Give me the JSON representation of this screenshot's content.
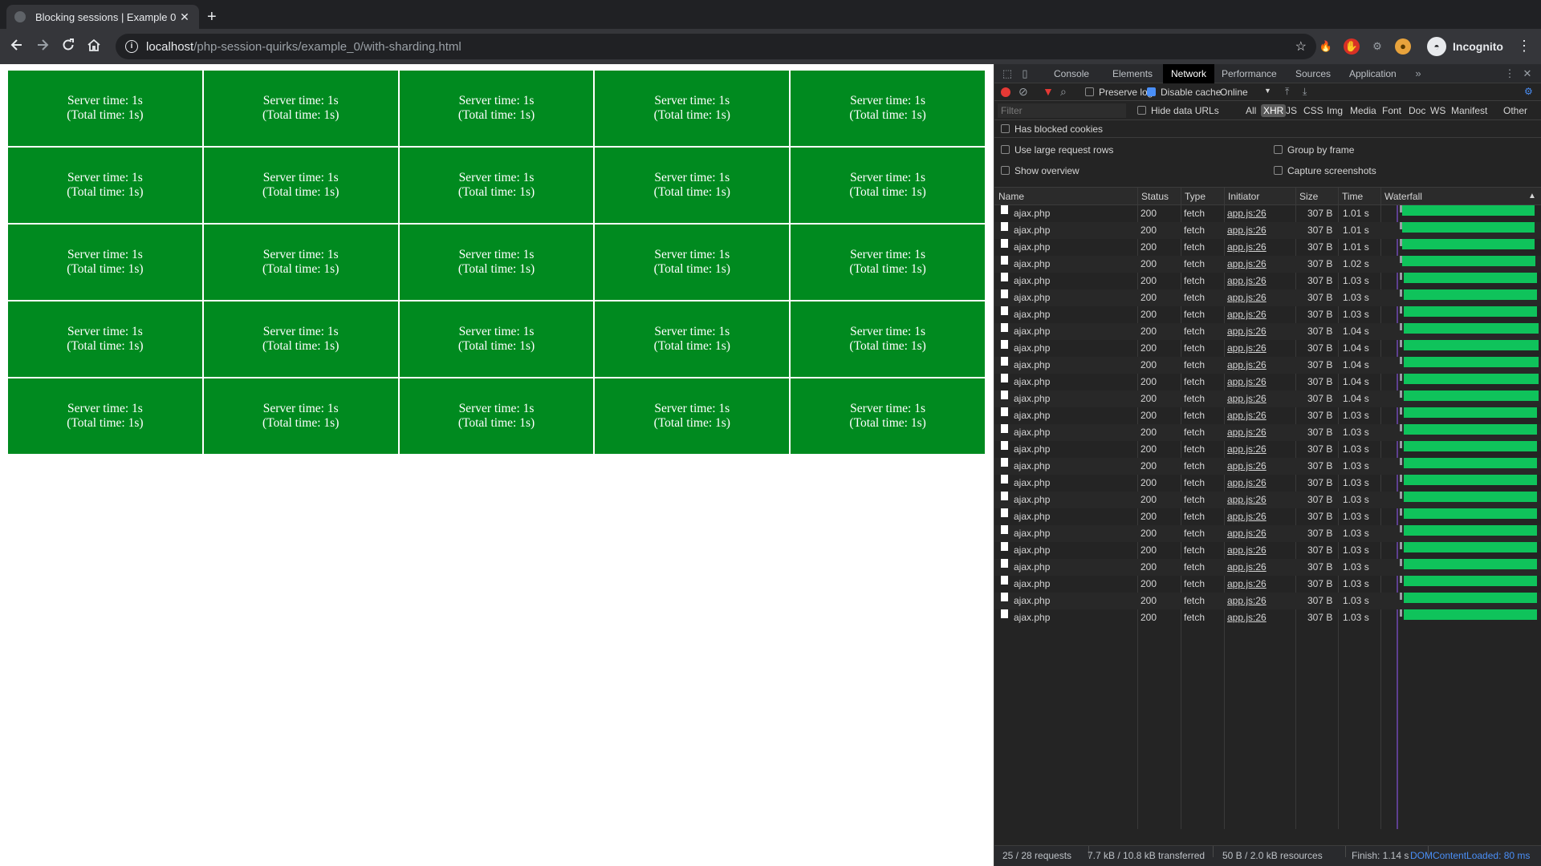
{
  "browser": {
    "tab_title": "Blocking sessions | Example 0",
    "tab_close": "✕",
    "new_tab": "+",
    "url_host": "localhost",
    "url_path": "/php-session-quirks/example_0/with-sharding.html",
    "profile_label": "Incognito"
  },
  "page": {
    "cells": [
      {
        "line1": "Server time: 1s",
        "line2": "(Total time: 1s)"
      },
      {
        "line1": "Server time: 1s",
        "line2": "(Total time: 1s)"
      },
      {
        "line1": "Server time: 1s",
        "line2": "(Total time: 1s)"
      },
      {
        "line1": "Server time: 1s",
        "line2": "(Total time: 1s)"
      },
      {
        "line1": "Server time: 1s",
        "line2": "(Total time: 1s)"
      },
      {
        "line1": "Server time: 1s",
        "line2": "(Total time: 1s)"
      },
      {
        "line1": "Server time: 1s",
        "line2": "(Total time: 1s)"
      },
      {
        "line1": "Server time: 1s",
        "line2": "(Total time: 1s)"
      },
      {
        "line1": "Server time: 1s",
        "line2": "(Total time: 1s)"
      },
      {
        "line1": "Server time: 1s",
        "line2": "(Total time: 1s)"
      },
      {
        "line1": "Server time: 1s",
        "line2": "(Total time: 1s)"
      },
      {
        "line1": "Server time: 1s",
        "line2": "(Total time: 1s)"
      },
      {
        "line1": "Server time: 1s",
        "line2": "(Total time: 1s)"
      },
      {
        "line1": "Server time: 1s",
        "line2": "(Total time: 1s)"
      },
      {
        "line1": "Server time: 1s",
        "line2": "(Total time: 1s)"
      },
      {
        "line1": "Server time: 1s",
        "line2": "(Total time: 1s)"
      },
      {
        "line1": "Server time: 1s",
        "line2": "(Total time: 1s)"
      },
      {
        "line1": "Server time: 1s",
        "line2": "(Total time: 1s)"
      },
      {
        "line1": "Server time: 1s",
        "line2": "(Total time: 1s)"
      },
      {
        "line1": "Server time: 1s",
        "line2": "(Total time: 1s)"
      },
      {
        "line1": "Server time: 1s",
        "line2": "(Total time: 1s)"
      },
      {
        "line1": "Server time: 1s",
        "line2": "(Total time: 1s)"
      },
      {
        "line1": "Server time: 1s",
        "line2": "(Total time: 1s)"
      },
      {
        "line1": "Server time: 1s",
        "line2": "(Total time: 1s)"
      },
      {
        "line1": "Server time: 1s",
        "line2": "(Total time: 1s)"
      }
    ],
    "cell_color": "#008a1f"
  },
  "devtools": {
    "tabs": [
      "Console",
      "Elements",
      "Network",
      "Performance",
      "Sources",
      "Application"
    ],
    "active_tab": "Network",
    "more_tabs": "»",
    "preserve_log": "Preserve log",
    "disable_cache": "Disable cache",
    "throttling": "Online",
    "filter_placeholder": "Filter",
    "hide_data_urls": "Hide data URLs",
    "type_filters": [
      "All",
      "XHR",
      "JS",
      "CSS",
      "Img",
      "Media",
      "Font",
      "Doc",
      "WS",
      "Manifest",
      "Other"
    ],
    "active_type": "XHR",
    "has_blocked_cookies": "Has blocked cookies",
    "use_large_rows": "Use large request rows",
    "group_by_frame": "Group by frame",
    "show_overview": "Show overview",
    "capture_screenshots": "Capture screenshots",
    "columns": [
      "Name",
      "Status",
      "Type",
      "Initiator",
      "Size",
      "Time",
      "Waterfall"
    ],
    "sort_indicator": "▲",
    "requests": [
      {
        "name": "ajax.php",
        "status": "200",
        "type": "fetch",
        "initiator": "app.js:26",
        "size": "307 B",
        "time": "1.01 s"
      },
      {
        "name": "ajax.php",
        "status": "200",
        "type": "fetch",
        "initiator": "app.js:26",
        "size": "307 B",
        "time": "1.01 s"
      },
      {
        "name": "ajax.php",
        "status": "200",
        "type": "fetch",
        "initiator": "app.js:26",
        "size": "307 B",
        "time": "1.01 s"
      },
      {
        "name": "ajax.php",
        "status": "200",
        "type": "fetch",
        "initiator": "app.js:26",
        "size": "307 B",
        "time": "1.02 s"
      },
      {
        "name": "ajax.php",
        "status": "200",
        "type": "fetch",
        "initiator": "app.js:26",
        "size": "307 B",
        "time": "1.03 s"
      },
      {
        "name": "ajax.php",
        "status": "200",
        "type": "fetch",
        "initiator": "app.js:26",
        "size": "307 B",
        "time": "1.03 s"
      },
      {
        "name": "ajax.php",
        "status": "200",
        "type": "fetch",
        "initiator": "app.js:26",
        "size": "307 B",
        "time": "1.03 s"
      },
      {
        "name": "ajax.php",
        "status": "200",
        "type": "fetch",
        "initiator": "app.js:26",
        "size": "307 B",
        "time": "1.04 s"
      },
      {
        "name": "ajax.php",
        "status": "200",
        "type": "fetch",
        "initiator": "app.js:26",
        "size": "307 B",
        "time": "1.04 s"
      },
      {
        "name": "ajax.php",
        "status": "200",
        "type": "fetch",
        "initiator": "app.js:26",
        "size": "307 B",
        "time": "1.04 s"
      },
      {
        "name": "ajax.php",
        "status": "200",
        "type": "fetch",
        "initiator": "app.js:26",
        "size": "307 B",
        "time": "1.04 s"
      },
      {
        "name": "ajax.php",
        "status": "200",
        "type": "fetch",
        "initiator": "app.js:26",
        "size": "307 B",
        "time": "1.04 s"
      },
      {
        "name": "ajax.php",
        "status": "200",
        "type": "fetch",
        "initiator": "app.js:26",
        "size": "307 B",
        "time": "1.03 s"
      },
      {
        "name": "ajax.php",
        "status": "200",
        "type": "fetch",
        "initiator": "app.js:26",
        "size": "307 B",
        "time": "1.03 s"
      },
      {
        "name": "ajax.php",
        "status": "200",
        "type": "fetch",
        "initiator": "app.js:26",
        "size": "307 B",
        "time": "1.03 s"
      },
      {
        "name": "ajax.php",
        "status": "200",
        "type": "fetch",
        "initiator": "app.js:26",
        "size": "307 B",
        "time": "1.03 s"
      },
      {
        "name": "ajax.php",
        "status": "200",
        "type": "fetch",
        "initiator": "app.js:26",
        "size": "307 B",
        "time": "1.03 s"
      },
      {
        "name": "ajax.php",
        "status": "200",
        "type": "fetch",
        "initiator": "app.js:26",
        "size": "307 B",
        "time": "1.03 s"
      },
      {
        "name": "ajax.php",
        "status": "200",
        "type": "fetch",
        "initiator": "app.js:26",
        "size": "307 B",
        "time": "1.03 s"
      },
      {
        "name": "ajax.php",
        "status": "200",
        "type": "fetch",
        "initiator": "app.js:26",
        "size": "307 B",
        "time": "1.03 s"
      },
      {
        "name": "ajax.php",
        "status": "200",
        "type": "fetch",
        "initiator": "app.js:26",
        "size": "307 B",
        "time": "1.03 s"
      },
      {
        "name": "ajax.php",
        "status": "200",
        "type": "fetch",
        "initiator": "app.js:26",
        "size": "307 B",
        "time": "1.03 s"
      },
      {
        "name": "ajax.php",
        "status": "200",
        "type": "fetch",
        "initiator": "app.js:26",
        "size": "307 B",
        "time": "1.03 s"
      },
      {
        "name": "ajax.php",
        "status": "200",
        "type": "fetch",
        "initiator": "app.js:26",
        "size": "307 B",
        "time": "1.03 s"
      },
      {
        "name": "ajax.php",
        "status": "200",
        "type": "fetch",
        "initiator": "app.js:26",
        "size": "307 B",
        "time": "1.03 s"
      }
    ],
    "status_bar": {
      "requests": "25 / 28 requests",
      "transferred": "7.7 kB / 10.8 kB transferred",
      "resources": "50 B / 2.0 kB resources",
      "finish": "Finish: 1.14 s",
      "dom_content_loaded": "DOMContentLoaded: 80 ms"
    },
    "colors": {
      "waterfall_bar": "#0fc35b",
      "dom_loaded": "#4a8ff7",
      "record": "#e53935"
    }
  }
}
